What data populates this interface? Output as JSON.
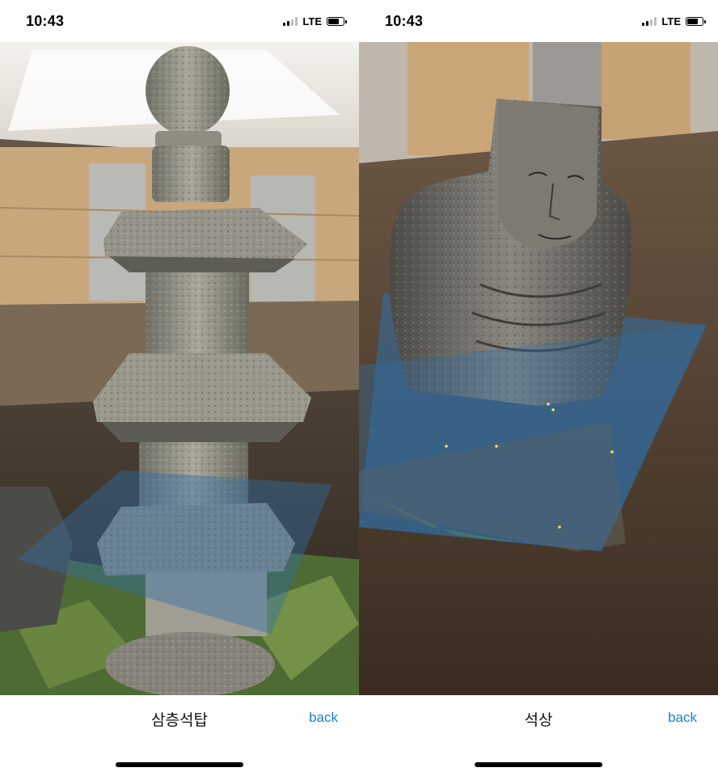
{
  "screens": [
    {
      "status": {
        "time": "10:43",
        "network": "LTE"
      },
      "title": "삼층석탑",
      "back_label": "back",
      "model_icon": "stone-pagoda-model"
    },
    {
      "status": {
        "time": "10:43",
        "network": "LTE"
      },
      "title": "석상",
      "back_label": "back",
      "model_icon": "stone-buddha-statue-model"
    }
  ],
  "colors": {
    "link": "#1a7fd0",
    "ar_plane": "#2f6fa8"
  }
}
